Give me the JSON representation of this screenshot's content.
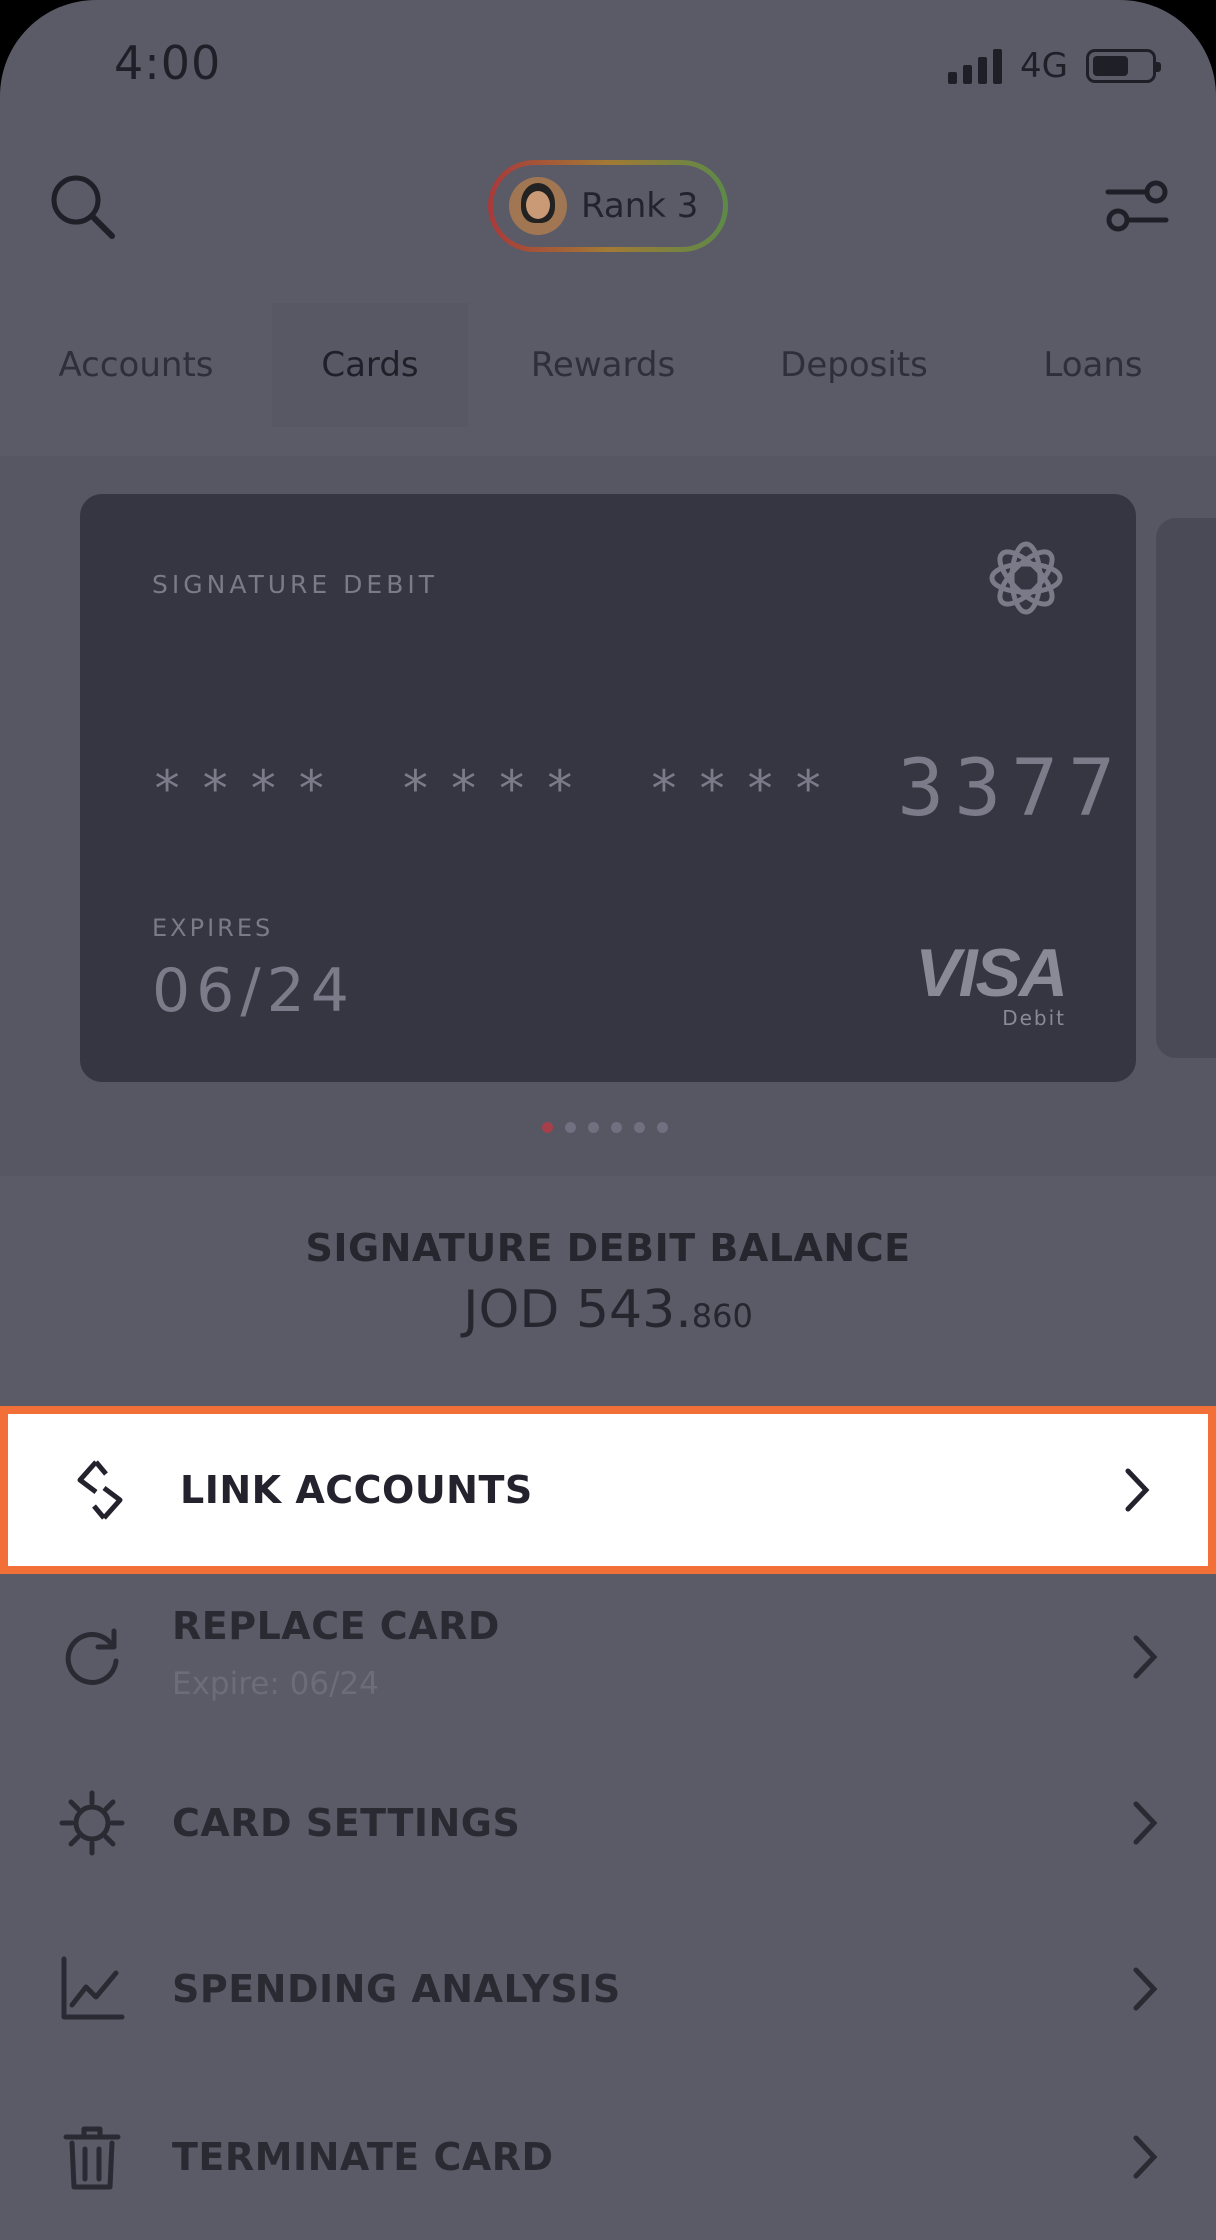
{
  "status_bar": {
    "time": "4:00",
    "network": "4G",
    "battery_level": 0.62
  },
  "header": {
    "rank_label": "Rank 3"
  },
  "tabs": [
    {
      "label": "Accounts",
      "active": false
    },
    {
      "label": "Cards",
      "active": true
    },
    {
      "label": "Rewards",
      "active": false
    },
    {
      "label": "Deposits",
      "active": false
    },
    {
      "label": "Loans",
      "active": false
    }
  ],
  "card": {
    "type": "SIGNATURE DEBIT",
    "masked_groups": [
      "****",
      "****",
      "****"
    ],
    "last4": "3377",
    "expires_label": "EXPIRES",
    "expires": "06/24",
    "network_brand": "VISA",
    "network_sub": "Debit",
    "pagination": {
      "count": 6,
      "active_index": 0
    }
  },
  "balance": {
    "title": "SIGNATURE DEBIT BALANCE",
    "amount_main": "JOD 543.",
    "amount_decimal": "860"
  },
  "menu": {
    "link_accounts": {
      "label": "LINK ACCOUNTS"
    },
    "replace_card": {
      "label": "REPLACE CARD",
      "sub": "Expire: 06/24"
    },
    "card_settings": {
      "label": "CARD SETTINGS"
    },
    "spending_analysis": {
      "label": "SPENDING ANALYSIS"
    },
    "terminate_card": {
      "label": "TERMINATE CARD"
    }
  },
  "colors": {
    "highlight_border": "#f27038",
    "active_dot": "#a5404a",
    "overlay_background": "#5b5b68"
  }
}
